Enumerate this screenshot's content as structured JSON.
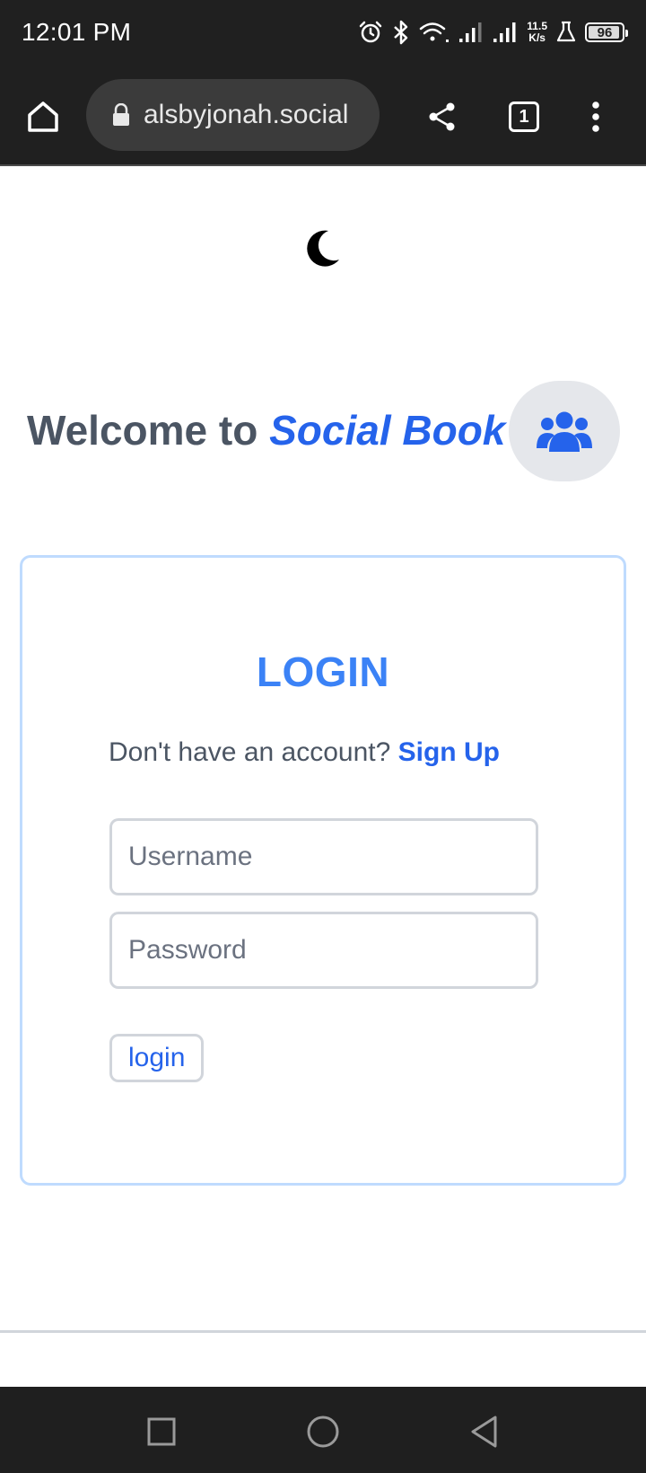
{
  "status_bar": {
    "time": "12:01 PM",
    "network_speed_value": "11.5",
    "network_speed_unit": "K/s",
    "battery_level": "96",
    "icons": [
      "alarm-icon",
      "bluetooth-icon",
      "wifi-icon",
      "signal-icon",
      "signal-icon",
      "lab-flask-icon",
      "battery-icon"
    ]
  },
  "browser": {
    "url": "alsbyjonah.social",
    "tab_count": "1",
    "icons": [
      "home-icon",
      "lock-icon",
      "share-icon",
      "tabs-icon",
      "more-vert-icon"
    ]
  },
  "page": {
    "theme_icon": "moon-icon",
    "welcome_prefix": "Welcome to ",
    "brand_name": "Social Book",
    "group_icon": "users-icon",
    "login": {
      "title": "LOGIN",
      "signup_prompt": "Don't have an account?",
      "signup_link": "Sign Up",
      "username_placeholder": "Username",
      "password_placeholder": "Password",
      "submit_label": "login"
    }
  },
  "nav_bar": {
    "icons": [
      "recents-square-icon",
      "home-circle-icon",
      "back-triangle-icon"
    ]
  },
  "colors": {
    "brand_blue": "#2563eb",
    "title_blue": "#3b82f6",
    "text_gray": "#4b5563",
    "card_border": "#bfdbfe",
    "system_bar": "#202020"
  }
}
